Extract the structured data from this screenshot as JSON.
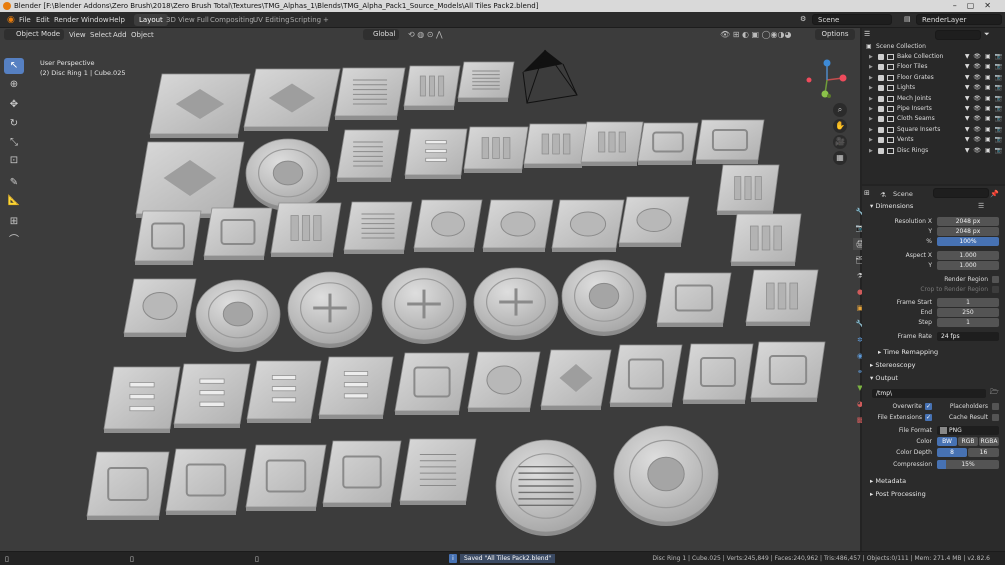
{
  "titlebar": {
    "title": "Blender [F:\\Blender Addons\\Zero Brush\\2018\\Zero Brush Total\\Textures\\TMG_Alphas_1\\Blends\\TMG_Alpha_Pack1_Source_Models\\All Tiles Pack2.blend]"
  },
  "menu": [
    "File",
    "Edit",
    "Render",
    "Window",
    "Help"
  ],
  "workspaces": [
    {
      "label": "Layout",
      "active": true
    },
    {
      "label": "3D View Full",
      "active": false
    },
    {
      "label": "Compositing",
      "active": false
    },
    {
      "label": "UV Editing",
      "active": false
    },
    {
      "label": "Scripting",
      "active": false
    }
  ],
  "topright": {
    "scene": "Scene",
    "viewlayer": "RenderLayer"
  },
  "viewport_header": {
    "mode": "Object Mode",
    "menus": [
      "View",
      "Select",
      "Add",
      "Object"
    ],
    "orientation": "Global",
    "options": "Options"
  },
  "viewport_info": {
    "view": "User Perspective",
    "object": "(2) Disc Ring 1 | Cube.025"
  },
  "outliner": {
    "root": "Scene Collection",
    "items": [
      "Bake Collection",
      "Floor Tiles",
      "Floor Grates",
      "Lights",
      "Mech Joints",
      "Pipe Inserts",
      "Cloth Seams",
      "Square Inserts",
      "Vents",
      "Disc Rings"
    ]
  },
  "properties": {
    "scene_label": "Scene",
    "dimensions_label": "Dimensions",
    "resolution_x_label": "Resolution X",
    "resolution_x": "2048 px",
    "y_label": "Y",
    "resolution_y": "2048 px",
    "percent_label": "%",
    "percent": "100%",
    "aspect_x_label": "Aspect X",
    "aspect_x": "1.000",
    "aspect_y_label": "Y",
    "aspect_y": "1.000",
    "render_region_label": "Render Region",
    "crop_label": "Crop to Render Region",
    "frame_start_label": "Frame Start",
    "frame_start": "1",
    "end_label": "End",
    "frame_end": "250",
    "step_label": "Step",
    "frame_step": "1",
    "frame_rate_label": "Frame Rate",
    "frame_rate": "24 fps",
    "time_remapping": "Time Remapping",
    "stereoscopy": "Stereoscopy",
    "output_label": "Output",
    "output_path": "/tmp\\",
    "overwrite_label": "Overwrite",
    "placeholders_label": "Placeholders",
    "file_ext_label": "File Extensions",
    "cache_label": "Cache Result",
    "file_format_label": "File Format",
    "file_format": "PNG",
    "color_label": "Color",
    "color_opts": [
      "BW",
      "RGB",
      "RGBA"
    ],
    "depth_label": "Color Depth",
    "depth_opts": [
      "8",
      "16"
    ],
    "compression_label": "Compression",
    "compression": "15%",
    "compression_fraction": 0.15,
    "metadata": "Metadata",
    "post": "Post Processing"
  },
  "status": {
    "saved": "Saved \"All Tiles Pack2.blend\"",
    "stats": "Disc Ring 1 | Cube.025 | Verts:245,849 | Faces:240,962 | Tris:486,457 | Objects:0/111 | Mem: 271.4 MB | v2.82.6"
  },
  "colors": {
    "accent": "#4772b3",
    "active_tool": "#5680c2",
    "bg_viewport": "#3c3c3c",
    "tile": "#c8c8c8"
  }
}
